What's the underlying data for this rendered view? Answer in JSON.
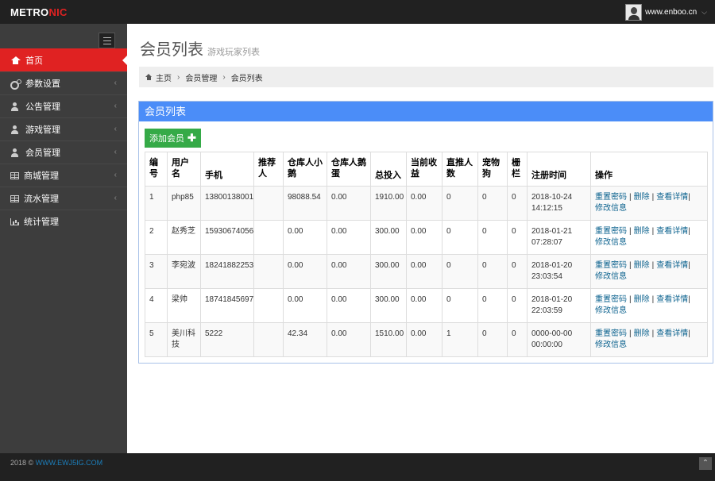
{
  "header": {
    "logo_main": "METRO",
    "logo_accent": "NIC",
    "user_name": "www.enboo.cn",
    "caret": "⌵"
  },
  "sidebar": {
    "items": [
      {
        "label": "首页",
        "icon": "home-icon",
        "active": true
      },
      {
        "label": "参数设置",
        "icon": "cogs-icon",
        "chevron": "‹"
      },
      {
        "label": "公告管理",
        "icon": "user-icon",
        "chevron": "‹"
      },
      {
        "label": "游戏管理",
        "icon": "user-icon",
        "chevron": "‹"
      },
      {
        "label": "会员管理",
        "icon": "user-icon",
        "chevron": "‹"
      },
      {
        "label": "商城管理",
        "icon": "table-icon",
        "chevron": "‹"
      },
      {
        "label": "流水管理",
        "icon": "table-icon",
        "chevron": "‹"
      },
      {
        "label": "统计管理",
        "icon": "bar-chart-icon"
      }
    ]
  },
  "page": {
    "title": "会员列表",
    "subtitle": "游戏玩家列表"
  },
  "breadcrumb": [
    "主页",
    "会员管理",
    "会员列表"
  ],
  "breadcrumb_sep": "›",
  "portlet": {
    "title": "会员列表",
    "add_button": "添加会员",
    "add_plus": "✚"
  },
  "table": {
    "headers": [
      "编号",
      "用户名",
      "手机",
      "推荐人",
      "仓库人小鹅",
      "仓库人鹅蛋",
      "总投入",
      "当前收益",
      "直推人数",
      "宠物狗",
      "栅栏",
      "注册时间",
      "操作"
    ],
    "rows": [
      [
        "1",
        "php85",
        "13800138001",
        "",
        "98088.54",
        "0.00",
        "1910.00",
        "0.00",
        "0",
        "0",
        "0",
        "2018-10-24 14:12:15"
      ],
      [
        "2",
        "赵秀芝",
        "15930674056",
        "",
        "0.00",
        "0.00",
        "300.00",
        "0.00",
        "0",
        "0",
        "0",
        "2018-01-21 07:28:07"
      ],
      [
        "3",
        "李宛波",
        "18241882253",
        "",
        "0.00",
        "0.00",
        "300.00",
        "0.00",
        "0",
        "0",
        "0",
        "2018-01-20 23:03:54"
      ],
      [
        "4",
        "梁帅",
        "18741845697",
        "",
        "0.00",
        "0.00",
        "300.00",
        "0.00",
        "0",
        "0",
        "0",
        "2018-01-20 22:03:59"
      ],
      [
        "5",
        "美川科技",
        "5222",
        "",
        "42.34",
        "0.00",
        "1510.00",
        "0.00",
        "1",
        "0",
        "0",
        "0000-00-00 00:00:00"
      ]
    ],
    "actions": {
      "reset_password": "重置密码",
      "delete": "删除",
      "view_details": "查看详情",
      "edit_info": "修改信息",
      "separator": "|"
    }
  },
  "footer": {
    "copyright": "2018 © ",
    "link": "WWW.EWJ5IG.COM",
    "go_top": "⌃"
  },
  "colors": {
    "brand_red": "#e02222",
    "portlet_blue": "#4b8df8",
    "button_green": "#35aa47",
    "link_blue": "#0d638f"
  }
}
